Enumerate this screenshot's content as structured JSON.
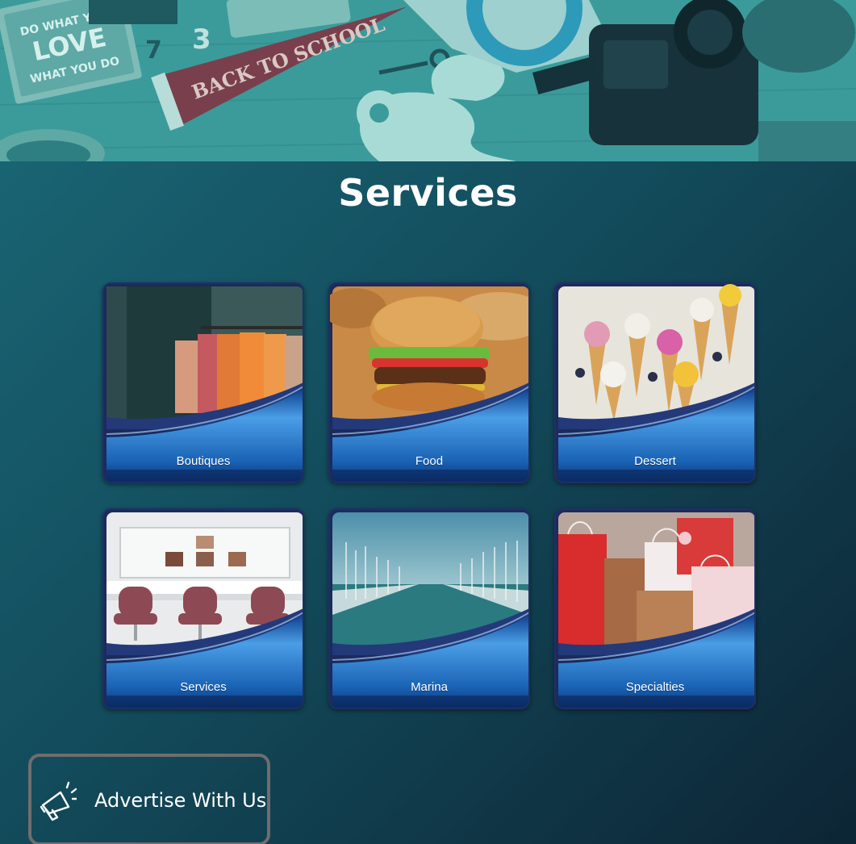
{
  "hero": {
    "icon": "desk-photo-banner",
    "pennant_text": "BACK TO SCHOOL",
    "notebook_text_lines": [
      "DO WHAT YOU",
      "LOVE",
      "WHAT YOU DO"
    ]
  },
  "page": {
    "title": "Services"
  },
  "categories": [
    {
      "label": "Boutiques",
      "icon": "clothing-rack-photo"
    },
    {
      "label": "Food",
      "icon": "burger-photo"
    },
    {
      "label": "Dessert",
      "icon": "ice-cream-cones-photo"
    },
    {
      "label": "Services",
      "icon": "salon-chairs-photo"
    },
    {
      "label": "Marina",
      "icon": "marina-photo"
    },
    {
      "label": "Specialties",
      "icon": "gift-bags-photo"
    }
  ],
  "advertise": {
    "label": "Advertise With Us",
    "icon": "megaphone-icon"
  },
  "colors": {
    "background_start": "#1b6a78",
    "background_end": "#0d2535",
    "tile_band": "#1a63b5",
    "tile_frame": "#1c2a5c",
    "advertise_border": "#6e6e6e"
  }
}
